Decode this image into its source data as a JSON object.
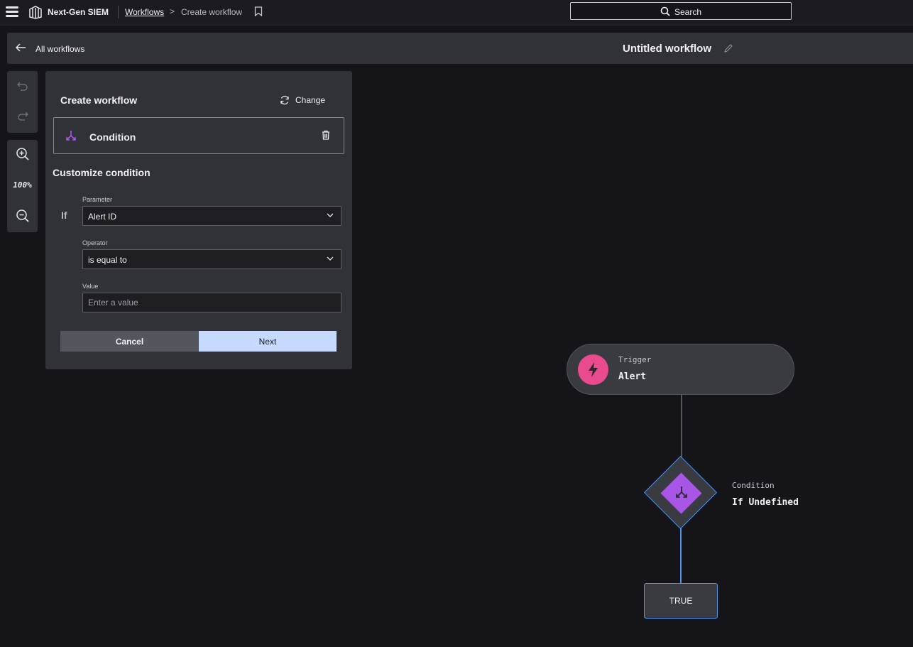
{
  "topbar": {
    "brand": "Next-Gen SIEM",
    "breadcrumb_link": "Workflows",
    "breadcrumb_separator": ">",
    "breadcrumb_current": "Create workflow",
    "search_label": "Search"
  },
  "subheader": {
    "back_label": "All workflows",
    "workflow_title": "Untitled workflow"
  },
  "toolrail": {
    "zoom_level": "100%"
  },
  "panel": {
    "title": "Create workflow",
    "change_label": "Change",
    "selected_action": "Condition",
    "section_title": "Customize condition",
    "if_label": "If",
    "parameter": {
      "label": "Parameter",
      "value": "Alert ID"
    },
    "operator": {
      "label": "Operator",
      "value": "is equal to"
    },
    "value": {
      "label": "Value",
      "placeholder": "Enter a value"
    },
    "cancel_label": "Cancel",
    "next_label": "Next"
  },
  "canvas": {
    "trigger": {
      "type": "Trigger",
      "name": "Alert"
    },
    "condition": {
      "type": "Condition",
      "name": "If Undefined"
    },
    "branch": {
      "label": "TRUE"
    }
  },
  "colors": {
    "accent_blue": "#4d90e8",
    "trigger_pink": "#ea4a8e",
    "condition_purple": "#a855e8",
    "next_button": "#c6daff"
  }
}
